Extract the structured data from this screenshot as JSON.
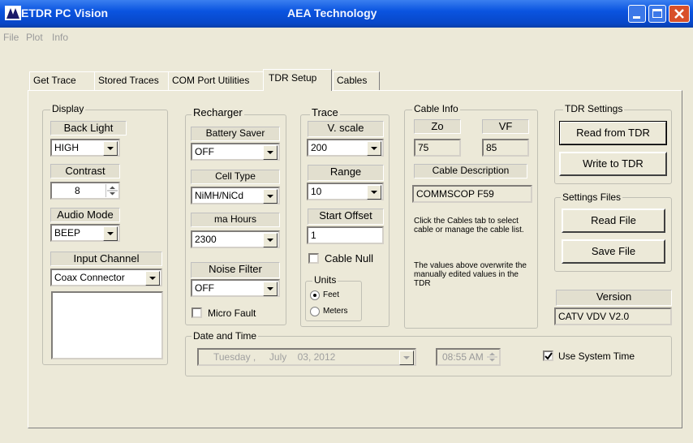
{
  "window": {
    "title": "ETDR PC Vision",
    "center_title": "AEA Technology"
  },
  "menu": [
    "File",
    "Plot",
    "Info"
  ],
  "tabs": [
    {
      "label": "Get Trace"
    },
    {
      "label": "Stored Traces"
    },
    {
      "label": "COM Port Utilities"
    },
    {
      "label": "TDR Setup"
    },
    {
      "label": "Cables"
    }
  ],
  "display": {
    "legend": "Display",
    "backlight_label": "Back Light",
    "backlight_value": "HIGH",
    "contrast_label": "Contrast",
    "contrast_value": "8",
    "audio_label": "Audio Mode",
    "audio_value": "BEEP",
    "input_label": "Input Channel",
    "input_value": "Coax Connector"
  },
  "recharger": {
    "legend": "Recharger",
    "battery_label": "Battery Saver",
    "battery_value": "OFF",
    "cell_label": "Cell Type",
    "cell_value": "NiMH/NiCd",
    "ma_label": "ma Hours",
    "ma_value": "2300",
    "noise_label": "Noise Filter",
    "noise_value": "OFF",
    "micro_label": "Micro Fault"
  },
  "trace": {
    "legend": "Trace",
    "vscale_label": "V. scale",
    "vscale_value": "200",
    "range_label": "Range",
    "range_value": "10",
    "offset_label": "Start Offset",
    "offset_value": "1",
    "cable_null_label": "Cable Null",
    "units_legend": "Units",
    "feet_label": "Feet",
    "meters_label": "Meters"
  },
  "cable_info": {
    "legend": "Cable Info",
    "zo_label": "Zo",
    "vf_label": "VF",
    "zo_value": "75",
    "vf_value": "85",
    "desc_label": "Cable Description",
    "desc_value": "COMMSCOP F59",
    "note1": "Click the Cables tab to select cable or manage the cable list.",
    "note2": "The values above overwrite the manually edited values in the TDR"
  },
  "tdr_settings": {
    "legend": "TDR Settings",
    "read_btn": "Read from TDR",
    "write_btn": "Write to TDR"
  },
  "settings_files": {
    "legend": "Settings Files",
    "read_btn": "Read File",
    "save_btn": "Save File"
  },
  "version": {
    "label": "Version",
    "value": "CATV VDV V2.0"
  },
  "datetime": {
    "legend": "Date and Time",
    "date_value": "Tuesday ,     July    03, 2012",
    "time_value": "08:55 AM",
    "use_system_label": "Use System Time"
  }
}
